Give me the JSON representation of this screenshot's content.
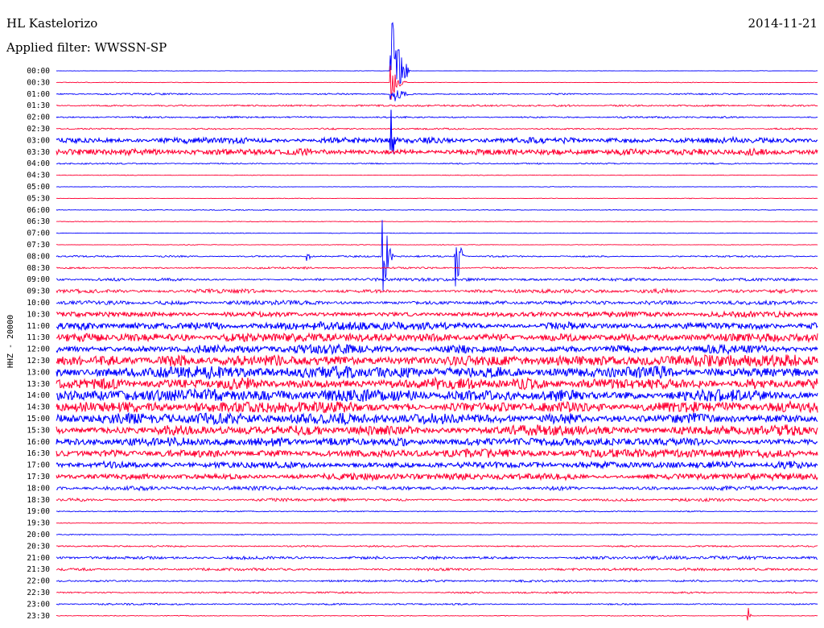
{
  "header": {
    "station": "HL Kastelorizo",
    "filter": "Applied filter: WWSSN-SP",
    "date": "2014-11-21"
  },
  "chart_data": {
    "type": "line",
    "title": "HL Kastelorizo",
    "subtitle": "Applied filter: WWSSN-SP",
    "date": "2014-11-21",
    "ylabel": "HHZ - 20000",
    "series_colors": [
      "#0000ff",
      "#ff0033"
    ],
    "time_labels": [
      "00:00",
      "00:30",
      "01:00",
      "01:30",
      "02:00",
      "02:30",
      "03:00",
      "03:30",
      "04:00",
      "04:30",
      "05:00",
      "05:30",
      "06:00",
      "06:30",
      "07:00",
      "07:30",
      "08:00",
      "08:30",
      "09:00",
      "09:30",
      "10:00",
      "10:30",
      "11:00",
      "11:30",
      "12:00",
      "12:30",
      "13:00",
      "13:30",
      "14:00",
      "14:30",
      "15:00",
      "15:30",
      "16:00",
      "16:30",
      "17:00",
      "17:30",
      "18:00",
      "18:30",
      "19:00",
      "19:30",
      "20:00",
      "20:30",
      "21:00",
      "21:30",
      "22:00",
      "22:30",
      "23:00",
      "23:30"
    ],
    "noise_amplitude": [
      0.2,
      0.3,
      0.8,
      0.8,
      0.8,
      0.8,
      3.0,
      3.0,
      0.7,
      0.3,
      0.3,
      0.3,
      0.4,
      0.3,
      0.3,
      0.4,
      0.8,
      0.8,
      1.3,
      2.0,
      2.0,
      2.5,
      3.5,
      4.0,
      5.0,
      5.5,
      5.5,
      5.5,
      5.5,
      5.0,
      5.0,
      5.0,
      4.0,
      4.0,
      3.5,
      3.0,
      2.0,
      1.5,
      0.5,
      0.4,
      0.5,
      0.8,
      1.5,
      1.3,
      1.0,
      0.8,
      0.8,
      0.4
    ],
    "events": [
      {
        "row": 0,
        "position": 0.44,
        "amplitude": 85,
        "duration": 0.025
      },
      {
        "row": 1,
        "position": 0.44,
        "amplitude": 25,
        "duration": 0.02
      },
      {
        "row": 2,
        "position": 0.44,
        "amplitude": 15,
        "duration": 0.03
      },
      {
        "row": 6,
        "position": 0.44,
        "amplitude": 40,
        "duration": 0.01
      },
      {
        "row": 16,
        "position": 0.43,
        "amplitude": 75,
        "duration": 0.012
      },
      {
        "row": 16,
        "position": 0.525,
        "amplitude": 55,
        "duration": 0.012
      },
      {
        "row": 16,
        "position": 0.33,
        "amplitude": 7,
        "duration": 0.01
      },
      {
        "row": 47,
        "position": 0.91,
        "amplitude": 10,
        "duration": 0.004
      }
    ]
  }
}
